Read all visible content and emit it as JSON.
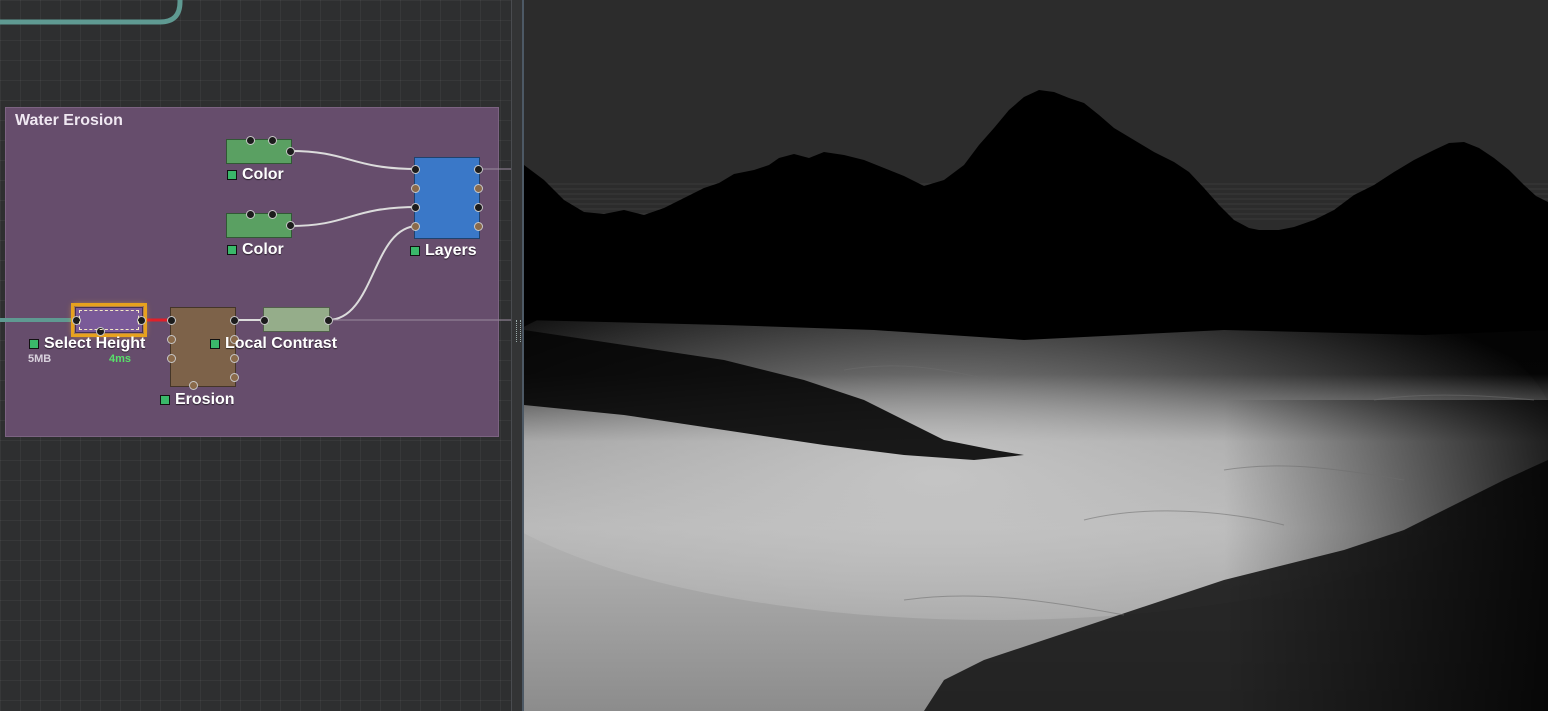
{
  "graph": {
    "group_title": "Water Erosion",
    "nodes": {
      "color1": {
        "label": "Color"
      },
      "color2": {
        "label": "Color"
      },
      "layers": {
        "label": "Layers"
      },
      "select_height": {
        "label": "Select Height",
        "memory": "5MB",
        "time": "4ms"
      },
      "erosion": {
        "label": "Erosion"
      },
      "local_contrast": {
        "label": "Local Contrast"
      }
    }
  },
  "viewport": {
    "scene": "terrain-render",
    "sky_color": "#2c2c2c",
    "fog_color": "#b8b8b8"
  },
  "colors": {
    "group": "#664d6c",
    "node_color": "#5aa062",
    "node_layers": "#3a78c8",
    "node_erosion": "#7d6249",
    "node_contrast": "#95ad8a",
    "node_select": "#7a5a98",
    "selection": "#e7a21e",
    "wire": "#d9d9d9",
    "active_wire": "#e0202a",
    "teal_wire": "#5f9a92"
  }
}
